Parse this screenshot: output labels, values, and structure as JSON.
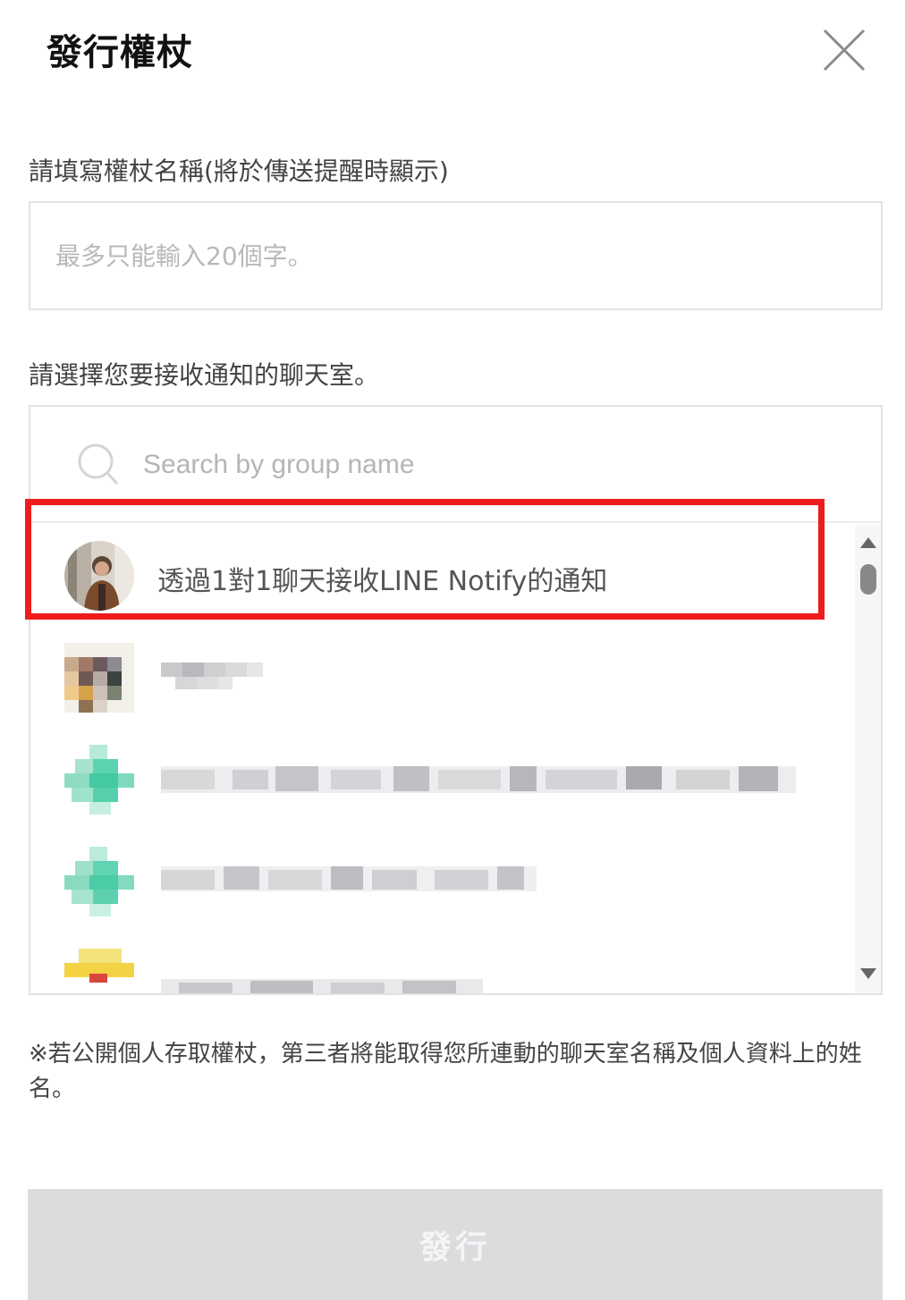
{
  "dialog": {
    "title": "發行權杖",
    "close_icon": "close-icon"
  },
  "token_name": {
    "label": "請填寫權杖名稱(將於傳送提醒時顯示)",
    "placeholder": "最多只能輸入20個字。",
    "value": ""
  },
  "chat_room": {
    "label": "請選擇您要接收通知的聊天室。",
    "search": {
      "icon": "search-icon",
      "placeholder": "Search by group name"
    },
    "items": [
      {
        "label": "透過1對1聊天接收LINE Notify的通知",
        "highlighted": true
      },
      {
        "label": "",
        "obscured": true
      },
      {
        "label": "",
        "obscured": true
      },
      {
        "label": "",
        "obscured": true
      },
      {
        "label": "",
        "obscured": true
      }
    ]
  },
  "notice": "※若公開個人存取權杖，第三者將能取得您所連動的聊天室名稱及個人資料上的姓名。",
  "issue_button": {
    "label": "發行",
    "enabled": false
  },
  "colors": {
    "highlight": "#ee1c1c",
    "button_disabled_bg": "#dcdcdf",
    "placeholder": "#b8b8b8"
  }
}
